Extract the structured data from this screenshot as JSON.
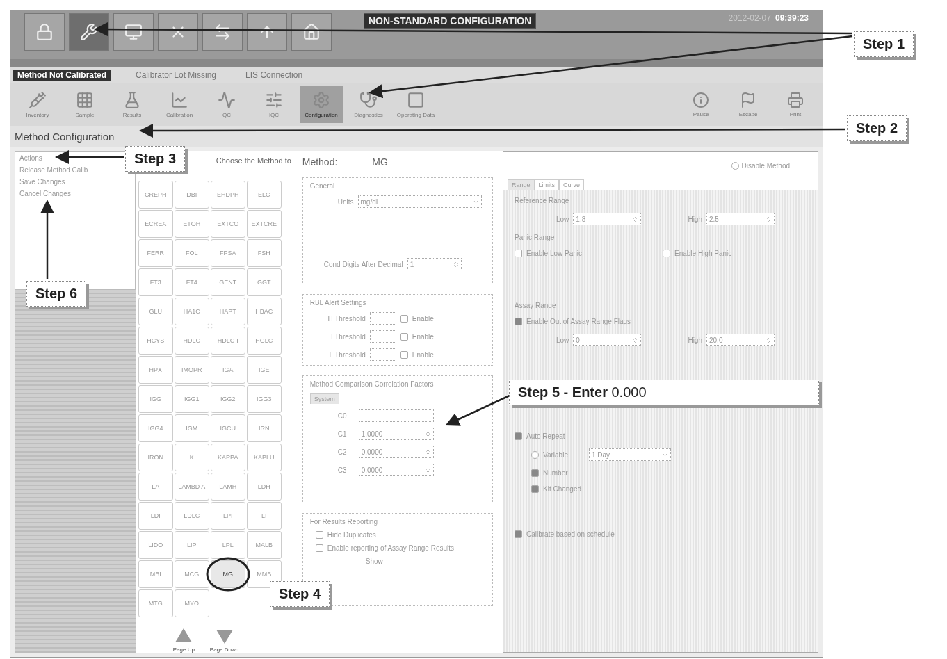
{
  "header": {
    "banner": "NON-STANDARD CONFIGURATION",
    "date": "2012-02-07",
    "time": "09:39:23",
    "top_buttons": [
      {
        "selected": false
      },
      {
        "selected": true
      },
      {
        "selected": false
      },
      {
        "selected": false
      },
      {
        "selected": false
      },
      {
        "selected": false
      },
      {
        "selected": false
      }
    ]
  },
  "alerts": [
    {
      "label": "Method Not Calibrated",
      "active": true
    },
    {
      "label": "Calibrator Lot Missing",
      "active": false
    },
    {
      "label": "LIS Connection",
      "active": false
    }
  ],
  "toolbar": [
    {
      "label": "Inventory",
      "selected": false
    },
    {
      "label": "Sample",
      "selected": false
    },
    {
      "label": "Results",
      "selected": false
    },
    {
      "label": "Calibration",
      "selected": false
    },
    {
      "label": "QC",
      "selected": false
    },
    {
      "label": "IQC",
      "selected": false
    },
    {
      "label": "Configuration",
      "selected": true
    },
    {
      "label": "Diagnostics",
      "selected": false
    },
    {
      "label": "Operating Data",
      "selected": false
    }
  ],
  "status_buttons": [
    {
      "label": "Pause"
    },
    {
      "label": "Escape"
    },
    {
      "label": "Print"
    }
  ],
  "page_title": "Method Configuration",
  "actions": {
    "title": "Actions",
    "items": [
      "Release Method Calib",
      "Save Changes",
      "Cancel Changes"
    ]
  },
  "method_list": {
    "title": "Choose the Method to",
    "tests": [
      {
        "label": "CREPH",
        "selected": false
      },
      {
        "label": "DBI",
        "selected": false
      },
      {
        "label": "EHDPH",
        "selected": false
      },
      {
        "label": "ELC",
        "selected": false
      },
      {
        "label": "ECREA",
        "selected": false
      },
      {
        "label": "ETOH",
        "selected": false
      },
      {
        "label": "EXTCO",
        "selected": false
      },
      {
        "label": "EXTCRE",
        "selected": false
      },
      {
        "label": "FERR",
        "selected": false
      },
      {
        "label": "FOL",
        "selected": false
      },
      {
        "label": "FPSA",
        "selected": false
      },
      {
        "label": "FSH",
        "selected": false
      },
      {
        "label": "FT3",
        "selected": false
      },
      {
        "label": "FT4",
        "selected": false
      },
      {
        "label": "GENT",
        "selected": false
      },
      {
        "label": "GGT",
        "selected": false
      },
      {
        "label": "GLU",
        "selected": false
      },
      {
        "label": "HA1C",
        "selected": false
      },
      {
        "label": "HAPT",
        "selected": false
      },
      {
        "label": "HBAC",
        "selected": false
      },
      {
        "label": "HCYS",
        "selected": false
      },
      {
        "label": "HDLC",
        "selected": false
      },
      {
        "label": "HDLC-I",
        "selected": false
      },
      {
        "label": "HGLC",
        "selected": false
      },
      {
        "label": "HPX",
        "selected": false
      },
      {
        "label": "IMOPR",
        "selected": false
      },
      {
        "label": "IGA",
        "selected": false
      },
      {
        "label": "IGE",
        "selected": false
      },
      {
        "label": "IGG",
        "selected": false
      },
      {
        "label": "IGG1",
        "selected": false
      },
      {
        "label": "IGG2",
        "selected": false
      },
      {
        "label": "IGG3",
        "selected": false
      },
      {
        "label": "IGG4",
        "selected": false
      },
      {
        "label": "IGM",
        "selected": false
      },
      {
        "label": "IGCU",
        "selected": false
      },
      {
        "label": "IRN",
        "selected": false
      },
      {
        "label": "IRON",
        "selected": false
      },
      {
        "label": "K",
        "selected": false
      },
      {
        "label": "KAPPA",
        "selected": false
      },
      {
        "label": "KAPLU",
        "selected": false
      },
      {
        "label": "LA",
        "selected": false
      },
      {
        "label": "LAMBD A",
        "selected": false
      },
      {
        "label": "LAMH",
        "selected": false
      },
      {
        "label": "LDH",
        "selected": false
      },
      {
        "label": "LDI",
        "selected": false
      },
      {
        "label": "LDLC",
        "selected": false
      },
      {
        "label": "LPI",
        "selected": false
      },
      {
        "label": "LI",
        "selected": false
      },
      {
        "label": "LIDO",
        "selected": false
      },
      {
        "label": "LIP",
        "selected": false
      },
      {
        "label": "LPL",
        "selected": false
      },
      {
        "label": "MALB",
        "selected": false
      },
      {
        "label": "MBI",
        "selected": false
      },
      {
        "label": "MCG",
        "selected": false
      },
      {
        "label": "MG",
        "selected": true
      },
      {
        "label": "MMB",
        "selected": false
      },
      {
        "label": "MTG",
        "selected": false
      },
      {
        "label": "MYO",
        "selected": false
      }
    ],
    "page_buttons": [
      "Page Up",
      "Page Down"
    ]
  },
  "method": {
    "label": "Method:",
    "value": "MG"
  },
  "disable_method": {
    "label": "Disable Method",
    "checked": false
  },
  "general": {
    "title": "General",
    "units_label": "Units",
    "units": "mg/dL",
    "digits_label": "Cond Digits After Decimal",
    "digits": "1"
  },
  "alert_settings": {
    "title": "RBL Alert Settings",
    "rows": [
      {
        "label": "H Threshold",
        "option": "Enable",
        "checked": false
      },
      {
        "label": "I Threshold",
        "option": "Enable",
        "checked": false
      },
      {
        "label": "L Threshold",
        "option": "Enable",
        "checked": false
      }
    ]
  },
  "correlation": {
    "title": "Method Comparison Correlation Factors",
    "tab": "System",
    "rows": [
      {
        "label": "C0"
      },
      {
        "label": "C1",
        "value": "1.0000"
      },
      {
        "label": "C2",
        "value": "0.0000"
      },
      {
        "label": "C3",
        "value": "0.0000"
      }
    ]
  },
  "reporting": {
    "title": "For Results Reporting",
    "options": [
      {
        "label": "Hide Duplicates",
        "checked": false
      },
      {
        "label": "Enable reporting of Assay Range Results",
        "checked": false
      }
    ],
    "extra": "Show"
  },
  "ranges": {
    "tabs": [
      {
        "label": "Range",
        "selected": true
      },
      {
        "label": "Limits",
        "selected": false
      },
      {
        "label": "Curve",
        "selected": false
      }
    ],
    "reference": {
      "title": "Reference Range",
      "low_label": "Low",
      "low": "1.8",
      "high_label": "High",
      "high": "2.5"
    },
    "panic": {
      "title": "Panic Range",
      "options": [
        {
          "label": "Enable Low Panic",
          "checked": false
        },
        {
          "label": "Enable High Panic",
          "checked": false
        }
      ]
    },
    "assay": {
      "title": "Assay Range",
      "option": {
        "label": "Enable Out of Assay Range Flags",
        "checked": true
      },
      "low_label": "Low",
      "low": "0",
      "high_label": "High",
      "high": "20.0"
    },
    "auto": {
      "label": "Auto Repeat",
      "checked": true,
      "options": [
        {
          "kind": "radio",
          "label": "Variable",
          "value": "1 Day",
          "selected": false
        },
        {
          "kind": "check",
          "label": "Number",
          "checked": true
        },
        {
          "kind": "check",
          "label": "Kit Changed",
          "checked": true
        }
      ]
    },
    "calibrate": {
      "label": "Calibrate based on schedule",
      "checked": true
    }
  },
  "annotations": [
    "Step 1",
    "Step 2",
    "Step 3",
    "Step 4",
    "**Step 5 - Enter** 0.000",
    "Step 6"
  ]
}
